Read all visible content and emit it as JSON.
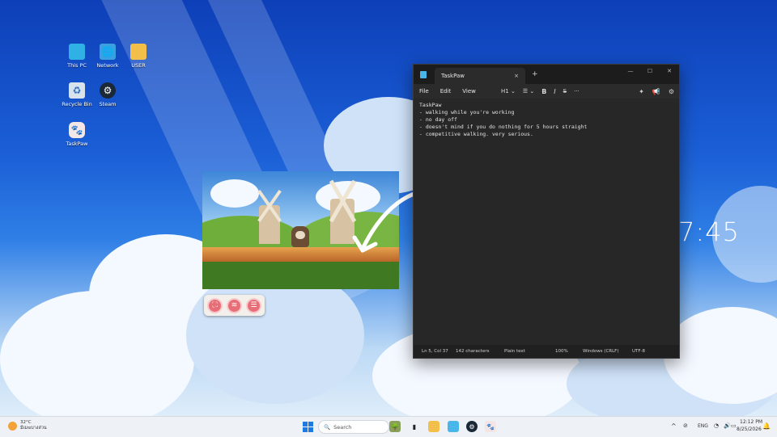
{
  "desktop": {
    "icons": [
      {
        "label": "This PC",
        "icon": "monitor-icon"
      },
      {
        "label": "Network",
        "icon": "network-icon"
      },
      {
        "label": "USER",
        "icon": "folder-icon"
      },
      {
        "label": "Recycle Bin",
        "icon": "recycle-bin-icon"
      },
      {
        "label": "Steam",
        "icon": "steam-icon"
      },
      {
        "label": "TaskPaw",
        "icon": "paw-icon"
      }
    ],
    "clock": "7:45"
  },
  "game_toolbar": {
    "buttons": [
      {
        "icon": "fullscreen-icon",
        "glyph": "⛶"
      },
      {
        "icon": "layers-icon",
        "glyph": "≋"
      },
      {
        "icon": "menu-icon",
        "glyph": "☰"
      }
    ]
  },
  "notepad": {
    "tab_title": "TaskPaw",
    "tab_close": "×",
    "new_tab": "+",
    "window_controls": {
      "minimize": "—",
      "maximize": "☐",
      "close": "✕"
    },
    "menu": [
      "File",
      "Edit",
      "View"
    ],
    "format_toolbar": {
      "heading": "H1 ⌄",
      "list": "☰ ⌄",
      "bold": "B",
      "italic": "I",
      "strike": "S",
      "more": "···"
    },
    "lines": [
      "TaskPaw",
      "- walking while you're working",
      "- no day off",
      "- doesn't mind if you do nothing for 5 hours straight",
      "- competitive walking. very serious."
    ],
    "status": {
      "position": "Ln 5, Col 37",
      "chars": "142 characters",
      "format": "Plain text",
      "zoom": "100%",
      "line_ending": "Windows (CRLF)",
      "encoding": "UTF-8"
    }
  },
  "taskbar": {
    "weather": {
      "temp": "32°C",
      "desc": "มีเมฆบางส่วน"
    },
    "search_placeholder": "Search",
    "tray": {
      "lang": "ENG",
      "time": "12:12 PM",
      "date": "8/25/2026"
    }
  }
}
